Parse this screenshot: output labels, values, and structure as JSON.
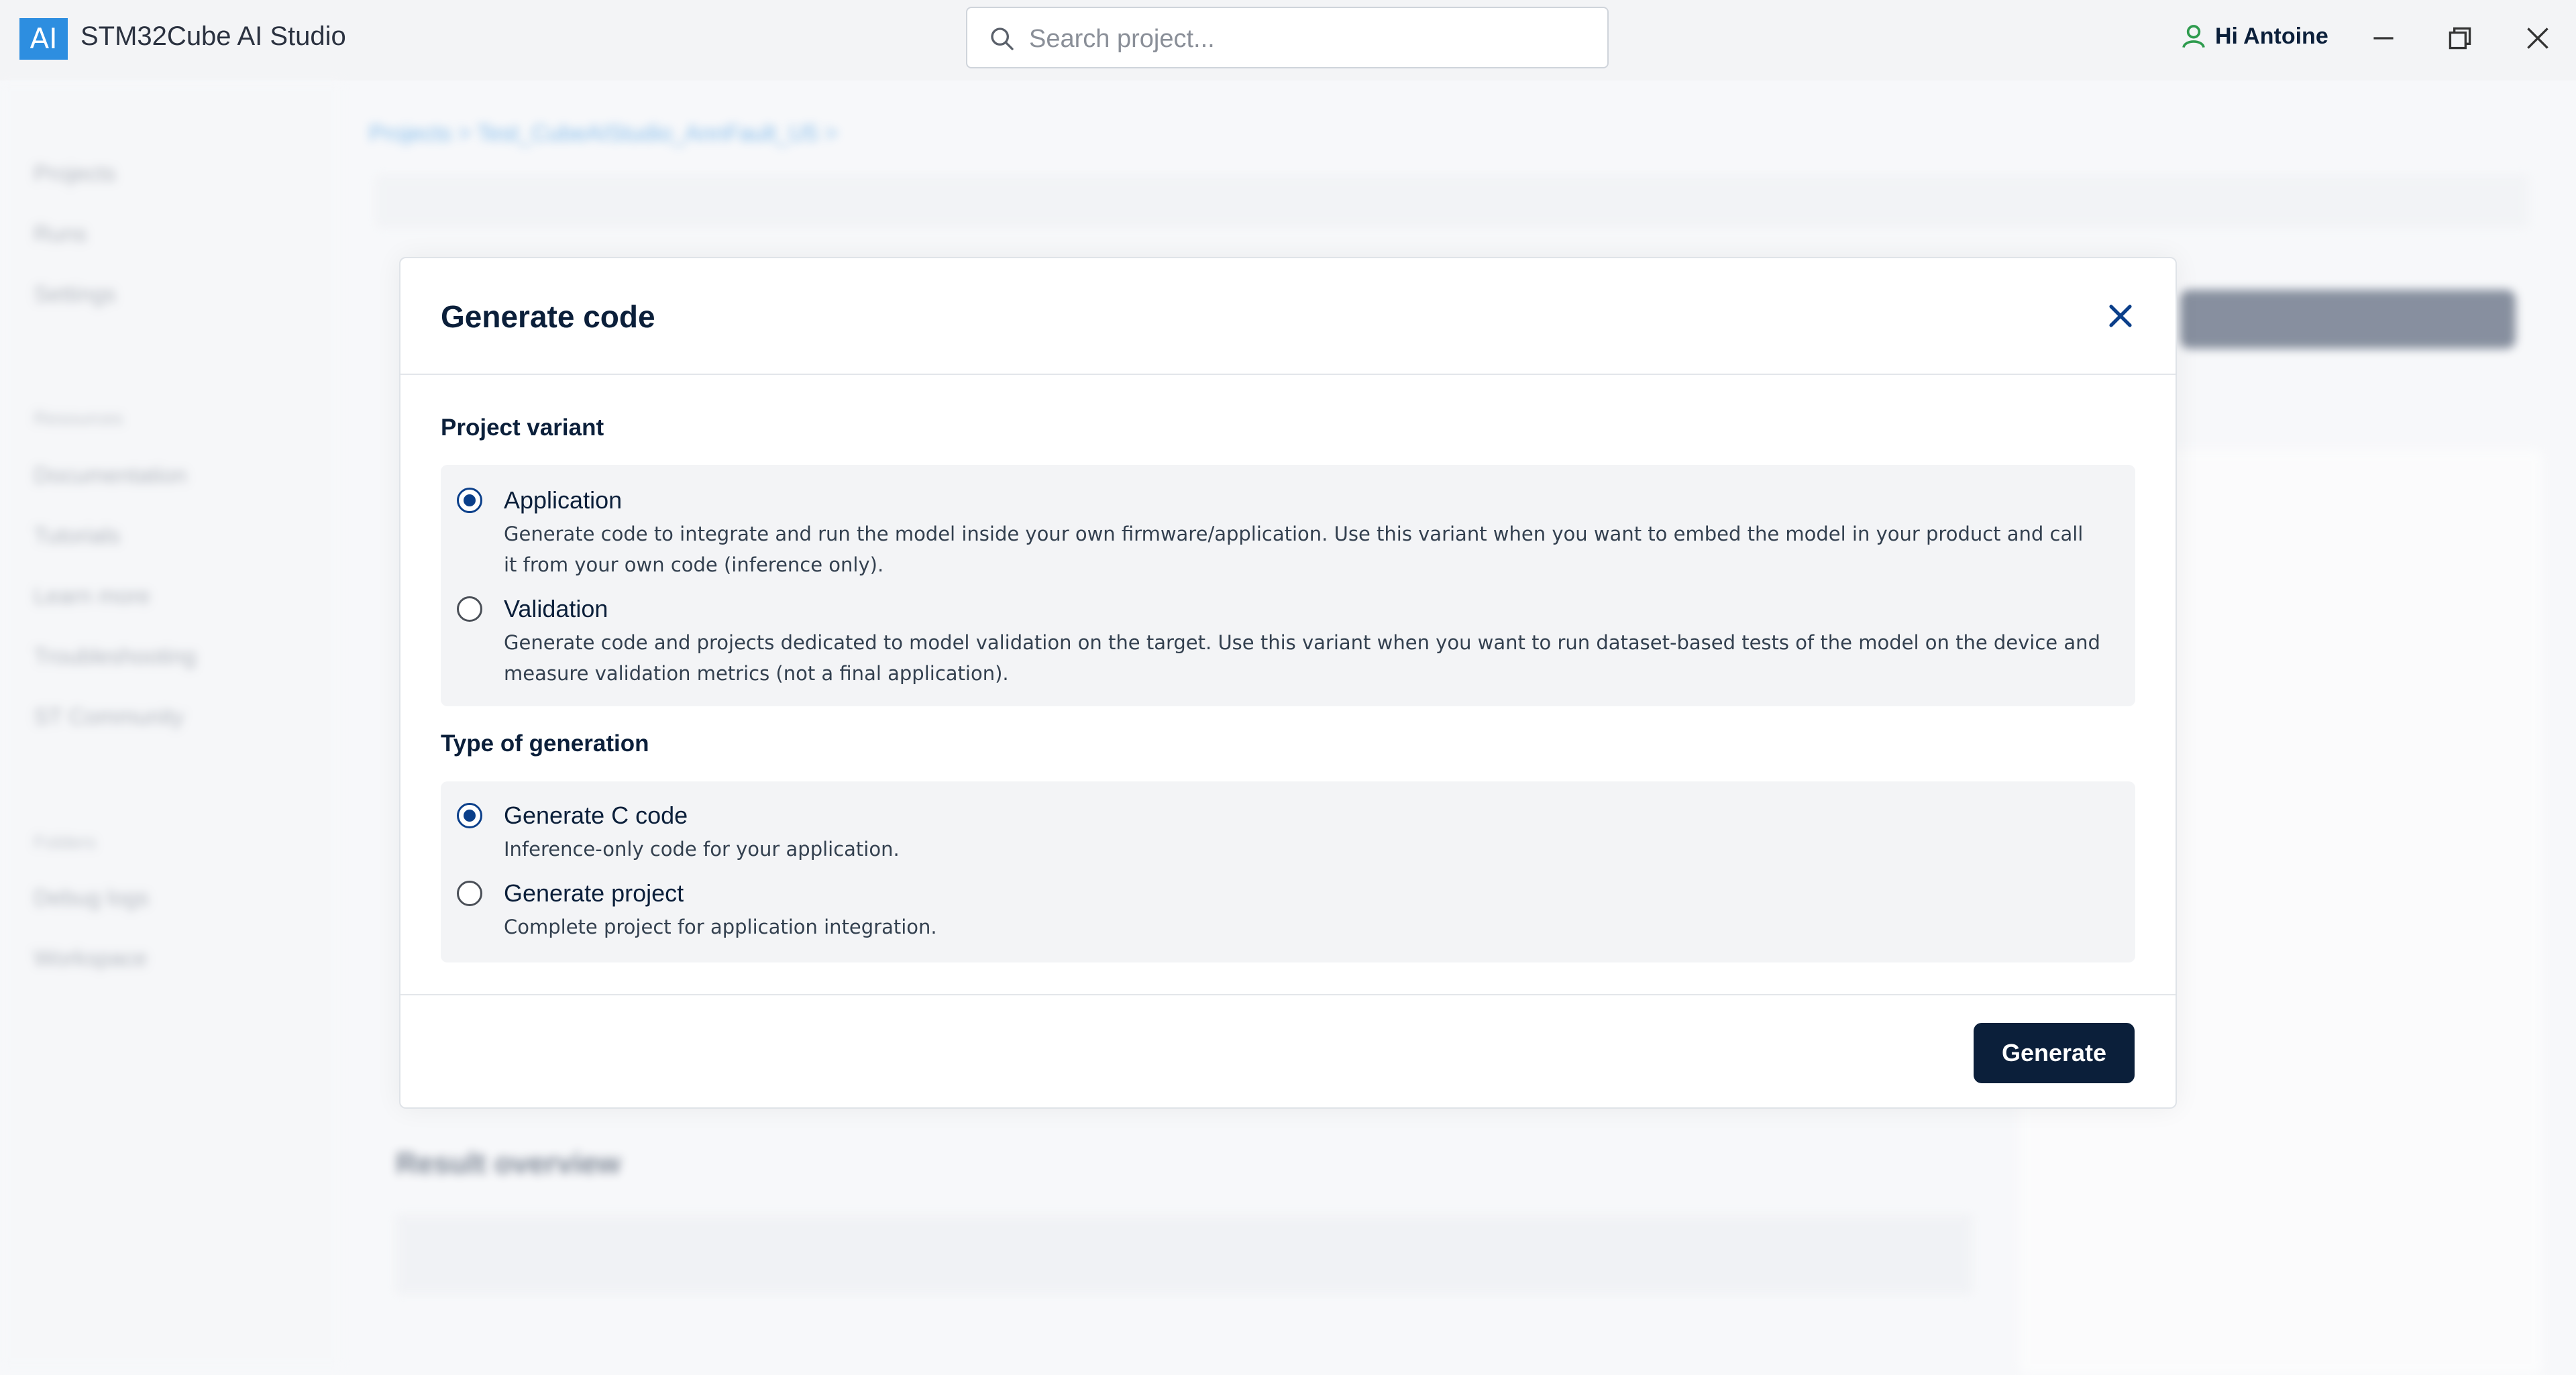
{
  "app": {
    "logo_text": "AI",
    "title": "STM32Cube AI Studio"
  },
  "search": {
    "placeholder": "Search project..."
  },
  "user": {
    "greeting": "Hi Antoine"
  },
  "background": {
    "sidebar_items": [
      "Projects",
      "Runs",
      "Settings"
    ],
    "resources_heading": "Resources",
    "resources_items": [
      "Documentation",
      "Tutorials",
      "Learn more",
      "Troubleshooting",
      "ST Community"
    ],
    "folders_heading": "Folders",
    "folders_items": [
      "Debug logs",
      "Workspace"
    ],
    "breadcrumb": "Projects  >  Test_CubeAIStudio_AnnFault_U5  >",
    "section_title": "Result overview"
  },
  "modal": {
    "title": "Generate code",
    "project_variant": {
      "label": "Project variant",
      "options": [
        {
          "title": "Application",
          "selected": true,
          "desc": "Generate code to integrate and run the model inside your own firmware/application. Use this variant when you want to embed the model in your product and call it from your own code (inference only)."
        },
        {
          "title": "Validation",
          "selected": false,
          "desc": "Generate code and projects dedicated to model validation on the target. Use this variant when you want to run dataset-based tests of the model on the device and measure validation metrics (not a final application)."
        }
      ]
    },
    "generation_type": {
      "label": "Type of generation",
      "options": [
        {
          "title": "Generate C code",
          "selected": true,
          "desc": "Inference-only code for your application."
        },
        {
          "title": "Generate project",
          "selected": false,
          "desc": "Complete project for application integration."
        }
      ]
    },
    "generate_label": "Generate"
  },
  "colors": {
    "accent": "#0b3f8a",
    "primary_button": "#0b1f3a",
    "logo_bg": "#2d8ee0",
    "user_icon": "#2e9b4e"
  }
}
